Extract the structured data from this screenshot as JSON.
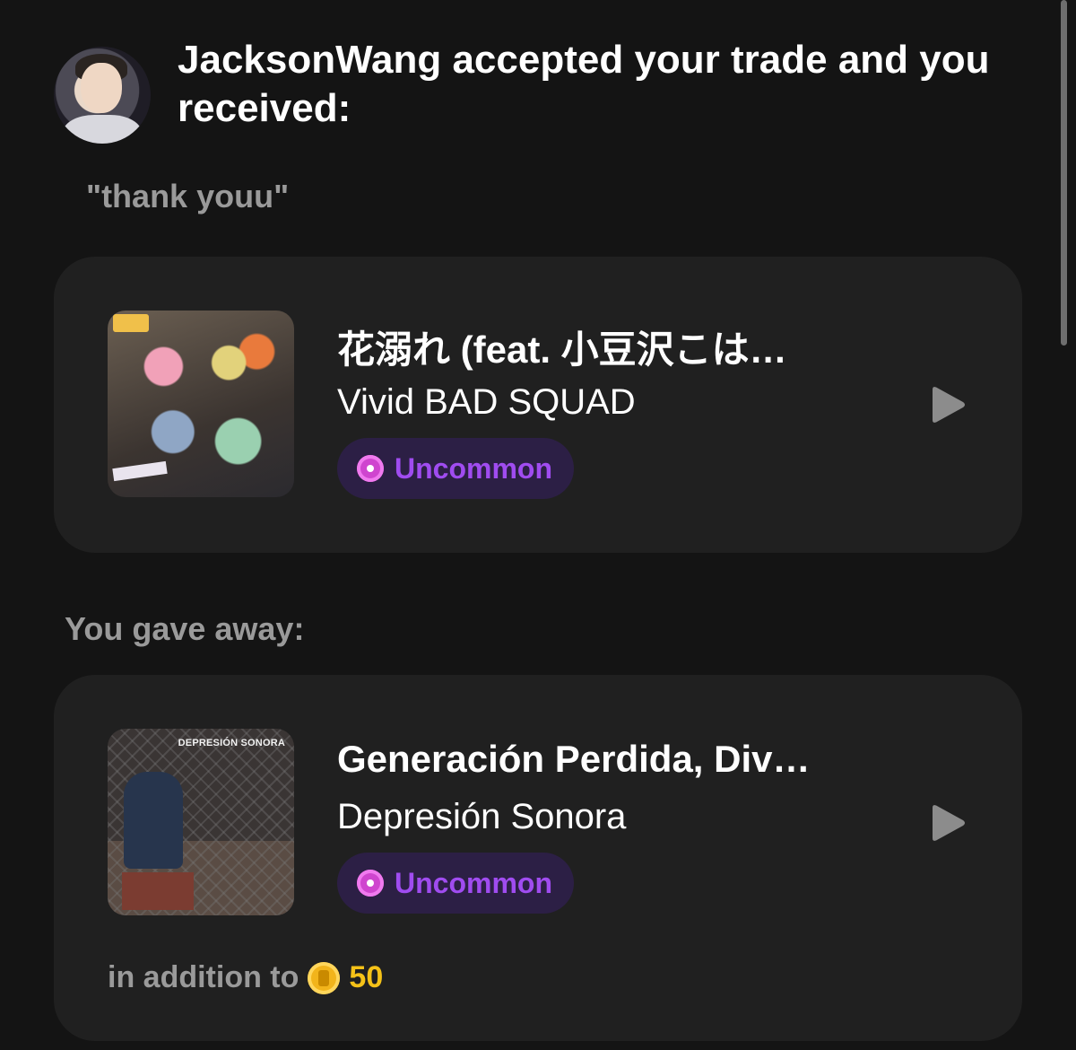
{
  "header": {
    "message": "JacksonWang accepted your trade and you received:",
    "note": "\"thank youu\""
  },
  "received": {
    "title": "花溺れ (feat. 小豆沢こは…",
    "artist": "Vivid BAD SQUAD",
    "rarity": "Uncommon",
    "rarity_icon": "uncommon-gem-icon",
    "rarity_color": "#a04cf0"
  },
  "gave_away": {
    "section_label": "You gave away:",
    "title": "Generación Perdida, Div…",
    "artist": "Depresión Sonora",
    "cover_text": "DEPRESIÓN SONORA",
    "rarity": "Uncommon",
    "rarity_icon": "uncommon-gem-icon",
    "addition_label": "in addition to",
    "coin_icon": "coin-icon",
    "coin_amount": "50",
    "coin_color": "#f5c218"
  },
  "theme": {
    "background": "#141414",
    "card": "#202020",
    "rarity_pill": "#2c1f45"
  }
}
